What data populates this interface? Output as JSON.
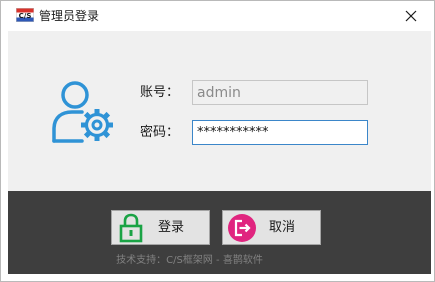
{
  "window": {
    "title": "管理员登录",
    "app_icon_text": "C/S"
  },
  "form": {
    "account_label": "账号：",
    "account_value": "admin",
    "password_label": "密码：",
    "password_value": "***********"
  },
  "buttons": {
    "login_label": "登录",
    "cancel_label": "取消"
  },
  "footer": {
    "text": "技术支持：C/S框架网 - 喜鹊软件"
  },
  "colors": {
    "accent_blue": "#2f93d6",
    "login_icon_green": "#1aa345",
    "cancel_icon_pink": "#e0257f",
    "bottom_bar": "#3e3e3e",
    "form_background": "#f0f0f0"
  },
  "icons": {
    "app": "cs-app-icon",
    "close": "close-icon",
    "user": "user-settings-icon",
    "login": "lock-icon",
    "cancel": "exit-icon"
  }
}
